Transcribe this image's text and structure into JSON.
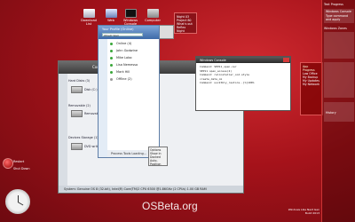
{
  "desktop_icons": [
    {
      "label": "Download List"
    },
    {
      "label": "Web"
    },
    {
      "label": "Windows Console"
    },
    {
      "label": "Computer"
    }
  ],
  "gadget": {
    "lines": [
      "Night 03",
      "Project 80",
      "What's out",
      "Reflex",
      "Night",
      "Projection"
    ]
  },
  "messenger": {
    "title": "Your Profile (Online)",
    "input_value": "What? Well",
    "vertical_label": "Windows Live Messenger 8 Beta",
    "contacts": [
      "Online (4)",
      "John Godwine",
      "Mike Lobo",
      "Lisa Nemesso",
      "Mark Hill",
      "Offline (2)"
    ],
    "footer": "Process Tools Loading..."
  },
  "explorer": {
    "title": "Computer",
    "groups": [
      "Hard Disks (3)",
      "Removable (2)",
      "Devices Storage (1)"
    ],
    "drives": [
      "Disk (C:)",
      "Removable Page (E:)",
      "DVD writer (D:)"
    ],
    "status": "System: Genuine OS 8 (32-bit), Intel(R) Core(TM)2 CPU 6300 @1.86GHz (2 CPUs)  1.00 GB RAM"
  },
  "context_menu": {
    "items": [
      "Options",
      "Show in",
      "Docked",
      "Auto-Position"
    ]
  },
  "console": {
    "title": "Windows Console",
    "lines": [
      "Command: SEP11_open.cer",
      "         SEP11 open_access(2)",
      "Command: relinstaller_cod.style",
      "         create_data_ok",
      "Command: uucktbly_restore..[%]100%"
    ]
  },
  "sidebar": {
    "header": "Text Progress",
    "items": [
      "Windows Console",
      "Type command and apply"
    ],
    "zone": "Windows Zones",
    "pane": [
      "App Progress",
      "Low Office",
      "My Backup",
      "My Updates",
      "My Network"
    ],
    "history_label": "History"
  },
  "taskbar": {
    "restart": "Restart",
    "shutdown": "Shut Down"
  },
  "brand": "OSBeta.org",
  "watermark_lines": [
    "Windows Like Next Gen",
    "Build 2013"
  ]
}
